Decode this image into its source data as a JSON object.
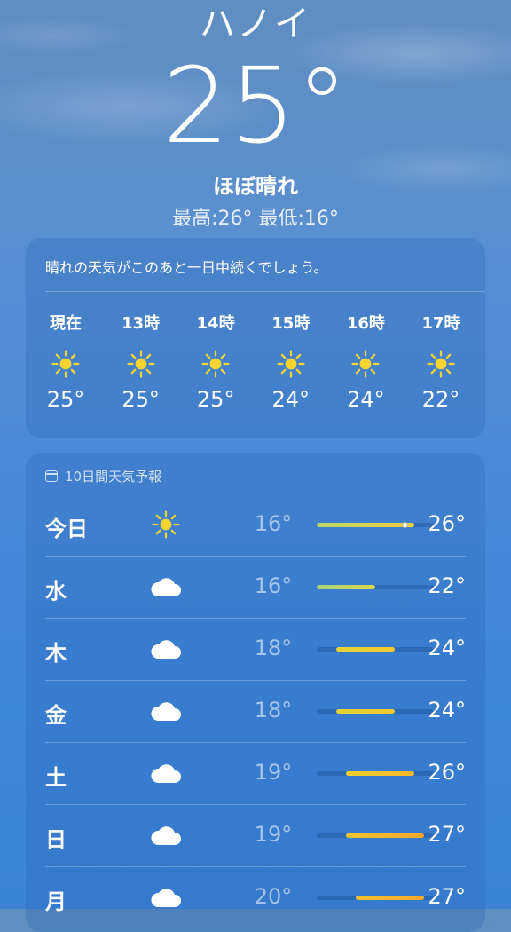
{
  "header": {
    "city": "ハノイ",
    "temperature": "25°",
    "condition": "ほぼ晴れ",
    "hilo": "最高:26°  最低:16°"
  },
  "hourly": {
    "summary": "晴れの天気がこのあと一日中続くでしょう。",
    "items": [
      {
        "label": "現在",
        "icon": "sun-icon",
        "temp": "25°"
      },
      {
        "label": "13時",
        "icon": "sun-icon",
        "temp": "25°"
      },
      {
        "label": "14時",
        "icon": "sun-icon",
        "temp": "25°"
      },
      {
        "label": "15時",
        "icon": "sun-icon",
        "temp": "24°"
      },
      {
        "label": "16時",
        "icon": "sun-icon",
        "temp": "24°"
      },
      {
        "label": "17時",
        "icon": "sun-icon",
        "temp": "22°"
      }
    ]
  },
  "daily": {
    "title": "10日間天気予報",
    "range_min": 16,
    "range_max": 28,
    "days": [
      {
        "day": "今日",
        "icon": "sun-icon",
        "low": "16°",
        "high": "26°",
        "low_val": 16,
        "high_val": 26,
        "current_val": 25,
        "bar_color": "linear-gradient(90deg,#b9d86a,#f2cf3a)"
      },
      {
        "day": "水",
        "icon": "cloud-icon",
        "low": "16°",
        "high": "22°",
        "low_val": 16,
        "high_val": 22,
        "bar_color": "linear-gradient(90deg,#a8d37c,#d9d74a)"
      },
      {
        "day": "木",
        "icon": "cloud-icon",
        "low": "18°",
        "high": "24°",
        "low_val": 18,
        "high_val": 24,
        "bar_color": "linear-gradient(90deg,#e3d23a,#f5c92e)"
      },
      {
        "day": "金",
        "icon": "cloud-icon",
        "low": "18°",
        "high": "24°",
        "low_val": 18,
        "high_val": 24,
        "bar_color": "linear-gradient(90deg,#e3d23a,#f5c92e)"
      },
      {
        "day": "土",
        "icon": "cloud-icon",
        "low": "19°",
        "high": "26°",
        "low_val": 19,
        "high_val": 26,
        "bar_color": "linear-gradient(90deg,#efcf30,#f7b82c)"
      },
      {
        "day": "日",
        "icon": "cloud-icon",
        "low": "19°",
        "high": "27°",
        "low_val": 19,
        "high_val": 27,
        "bar_color": "linear-gradient(90deg,#f1c630,#f7a82c)"
      },
      {
        "day": "月",
        "icon": "cloud-icon",
        "low": "20°",
        "high": "27°",
        "low_val": 20,
        "high_val": 27,
        "bar_color": "linear-gradient(90deg,#f3c130,#f7a82c)"
      }
    ]
  }
}
